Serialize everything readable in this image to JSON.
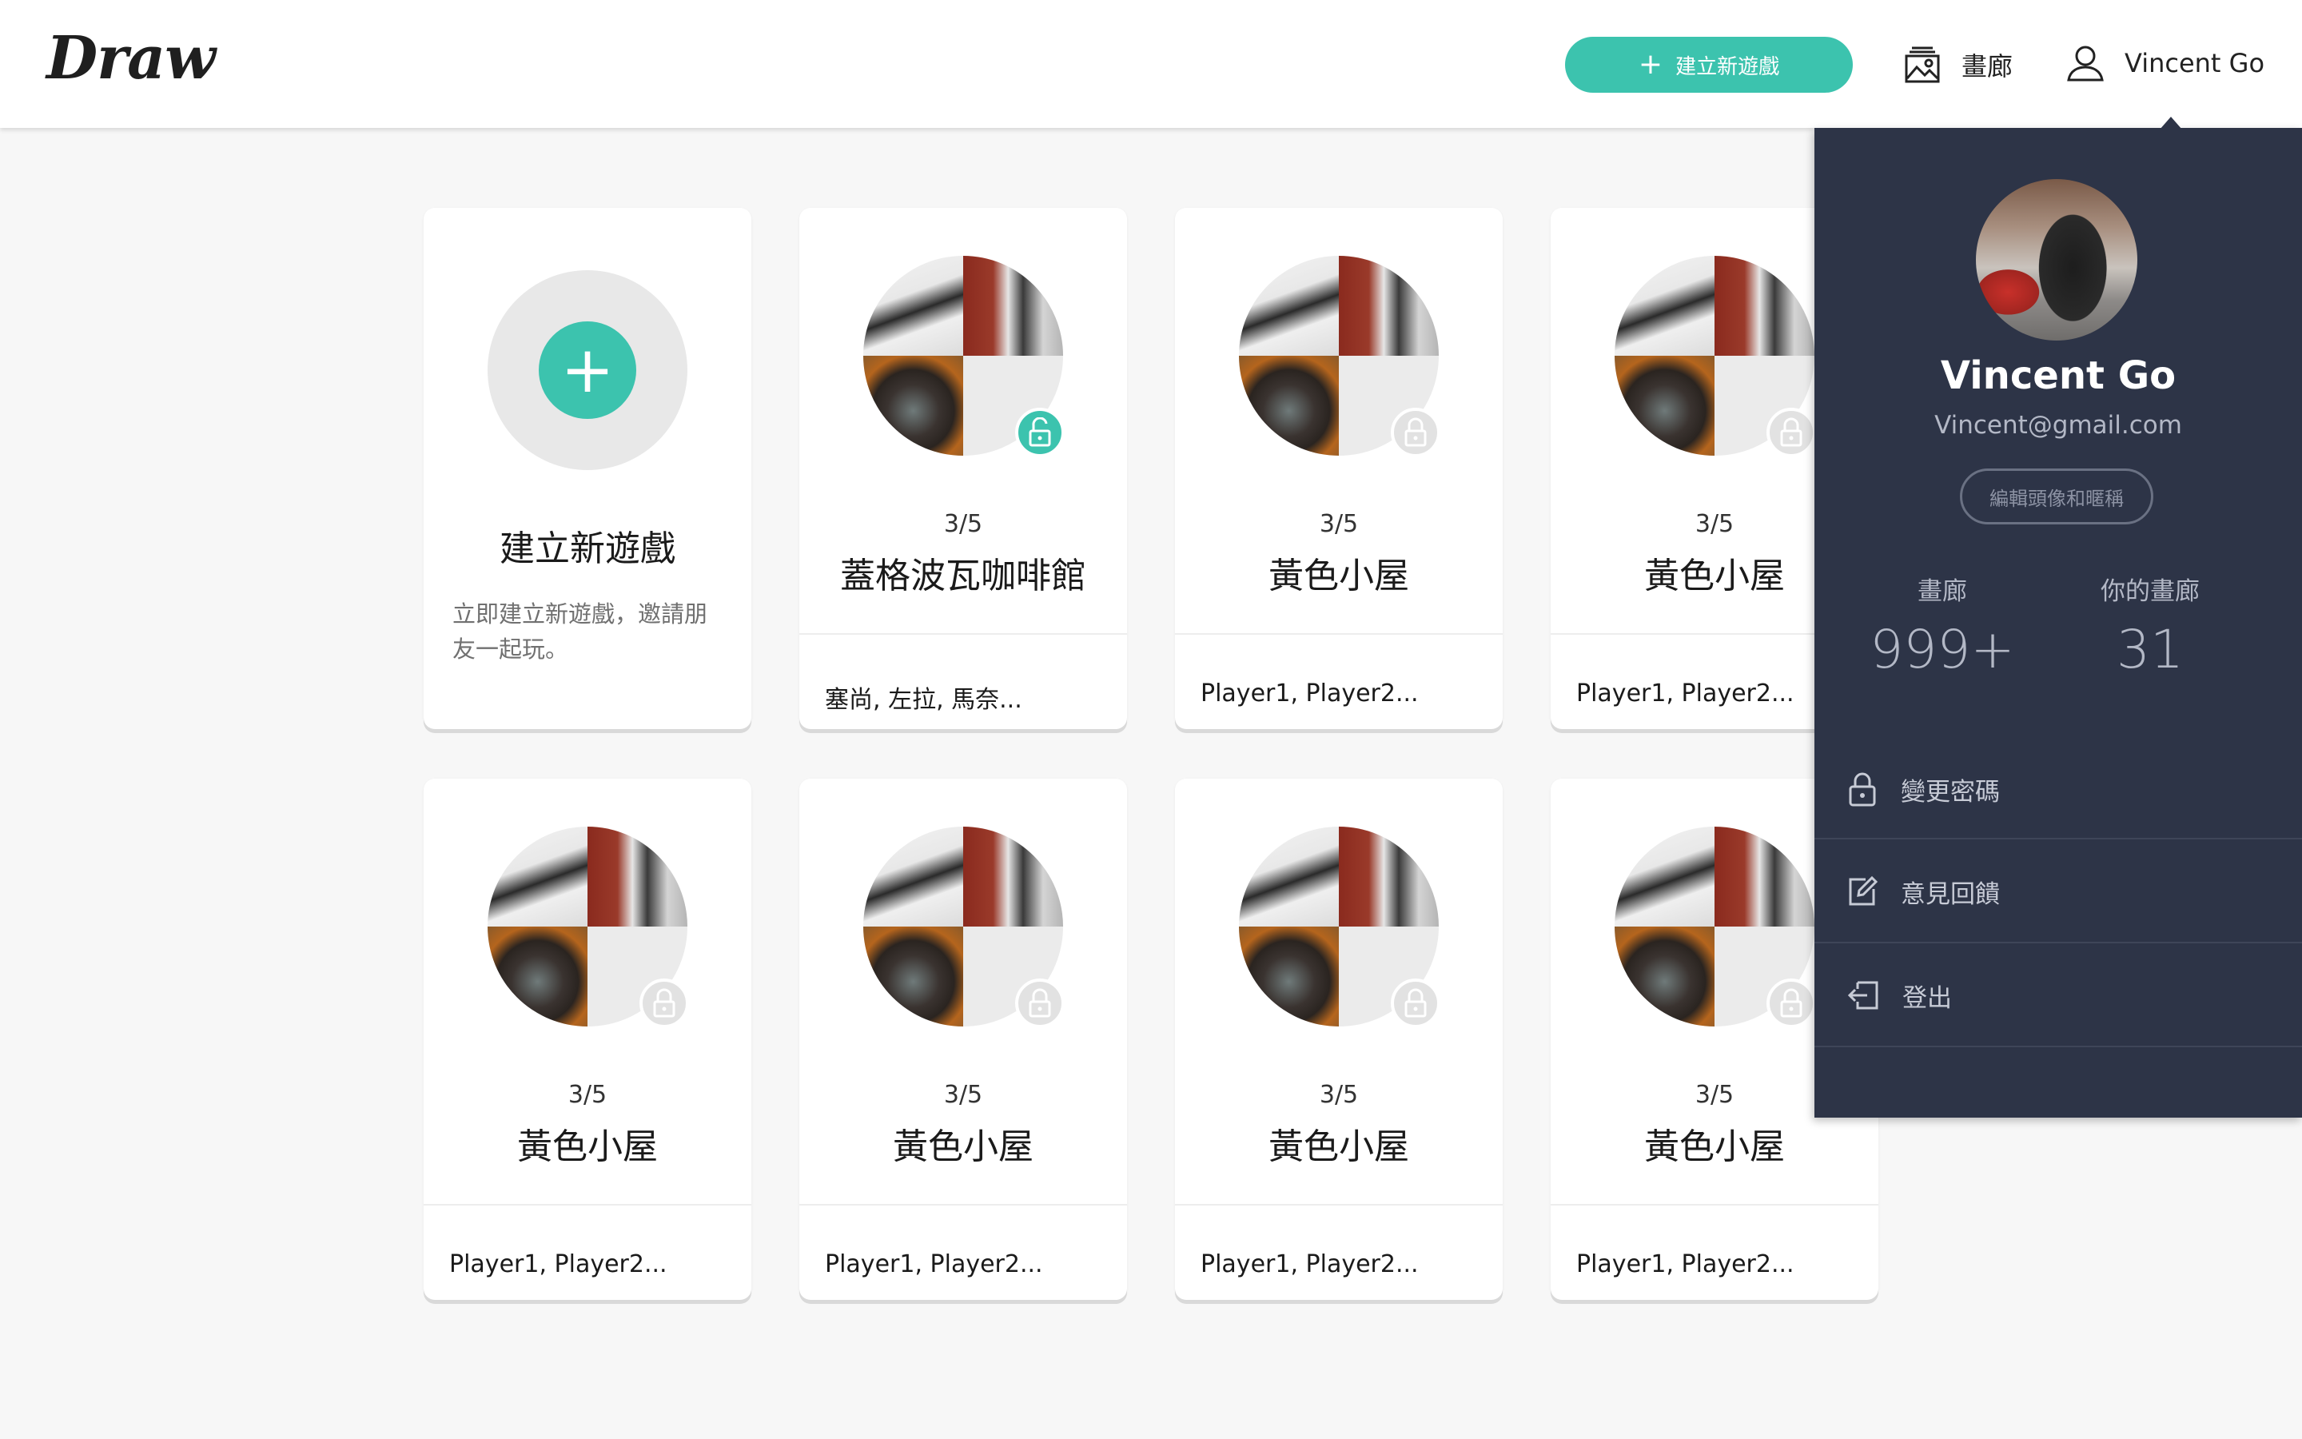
{
  "header": {
    "logo": "Draw",
    "create_button": "建立新遊戲",
    "gallery_label": "畫廊",
    "user_name": "Vincent Go"
  },
  "create_card": {
    "title": "建立新遊戲",
    "description": "立即建立新遊戲，邀請朋友一起玩。"
  },
  "games": [
    {
      "count": "3/5",
      "title": "蓋格波瓦咖啡館",
      "players": "塞尚, 左拉, 馬奈...",
      "locked": false
    },
    {
      "count": "3/5",
      "title": "黃色小屋",
      "players": "Player1, Player2...",
      "locked": true
    },
    {
      "count": "3/5",
      "title": "黃色小屋",
      "players": "Player1, Player2...",
      "locked": true
    },
    {
      "count": "3/5",
      "title": "黃色小屋",
      "players": "Player1, Player2...",
      "locked": true
    },
    {
      "count": "3/5",
      "title": "黃色小屋",
      "players": "Player1, Player2...",
      "locked": true
    },
    {
      "count": "3/5",
      "title": "黃色小屋",
      "players": "Player1, Player2...",
      "locked": true
    },
    {
      "count": "3/5",
      "title": "黃色小屋",
      "players": "Player1, Player2...",
      "locked": true
    }
  ],
  "profile_menu": {
    "name": "Vincent Go",
    "email": "Vincent@gmail.com",
    "edit_button": "編輯頭像和暱稱",
    "stats": [
      {
        "label": "畫廊",
        "value": "999+"
      },
      {
        "label": "你的畫廊",
        "value": "31"
      }
    ],
    "items": [
      {
        "label": "變更密碼",
        "icon": "lock-icon"
      },
      {
        "label": "意見回饋",
        "icon": "edit-icon"
      },
      {
        "label": "登出",
        "icon": "logout-icon"
      }
    ]
  },
  "colors": {
    "accent": "#3cc3ae",
    "panel_bg": "#2d3447",
    "page_bg": "#f7f7f7"
  }
}
